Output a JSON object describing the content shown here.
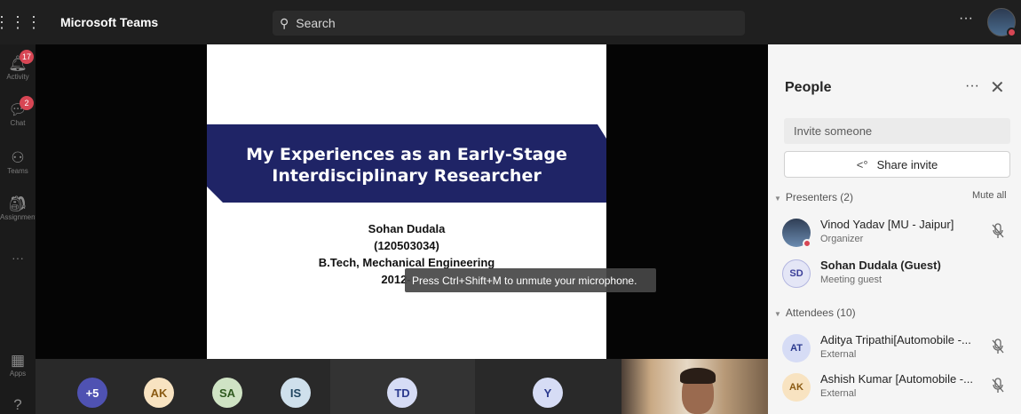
{
  "topbar": {
    "app_title": "Microsoft Teams",
    "search_placeholder": "Search",
    "more_label": "···"
  },
  "rail": {
    "items": [
      {
        "label": "Activity",
        "badge": "17",
        "icon": "bell-icon"
      },
      {
        "label": "Chat",
        "badge": "2",
        "icon": "chat-icon"
      },
      {
        "label": "Teams",
        "icon": "teams-icon"
      },
      {
        "label": "Assignments",
        "icon": "assignments-icon"
      },
      {
        "label": "···",
        "icon": "more-icon"
      },
      {
        "label": "Apps",
        "icon": "apps-icon"
      },
      {
        "label": "",
        "icon": "help-icon"
      }
    ]
  },
  "slide": {
    "title_line1": "My Experiences as an Early-Stage",
    "title_line2": "Interdisciplinary Researcher",
    "author": "Sohan Dudala",
    "roll": "(120503034)",
    "degree": "B.Tech, Mechanical Engineering",
    "years": "2012-"
  },
  "tooltip": "Press Ctrl+Shift+M to unmute your microphone.",
  "gallery": [
    {
      "initials": "+5",
      "bg": "#4f52b2",
      "fg": "#ffffff"
    },
    {
      "initials": "AK",
      "bg": "#f8e3c1",
      "fg": "#8a5a12"
    },
    {
      "initials": "SA",
      "bg": "#cfe3c4",
      "fg": "#2f5a1f"
    },
    {
      "initials": "IS",
      "bg": "#cfe0ec",
      "fg": "#1f4560"
    },
    {
      "initials": "TD",
      "bg": "#d6dcf5",
      "fg": "#2b3a8e"
    },
    {
      "initials": "Y",
      "bg": "#d6dcf5",
      "fg": "#2b3a8e"
    }
  ],
  "panel": {
    "title": "People",
    "more": "···",
    "close": "✕",
    "invite_placeholder": "Invite someone",
    "share_label": "Share invite",
    "presenters_label": "Presenters (2)",
    "mute_all": "Mute all",
    "attendees_label": "Attendees (10)",
    "presenters": [
      {
        "name": "Vinod Yadav [MU - Jaipur]",
        "role": "Organizer",
        "initials": "",
        "photo": true
      },
      {
        "name": "Sohan Dudala (Guest)",
        "role": "Meeting guest",
        "initials": "SD"
      }
    ],
    "attendees": [
      {
        "name": "Aditya Tripathi[Automobile -...",
        "role": "External",
        "initials": "AT"
      },
      {
        "name": "Ashish Kumar [Automobile -...",
        "role": "External",
        "initials": "AK"
      }
    ]
  },
  "colors": {
    "accent": "#4f52b2",
    "banner": "#1f2466",
    "badge": "#d74654"
  }
}
